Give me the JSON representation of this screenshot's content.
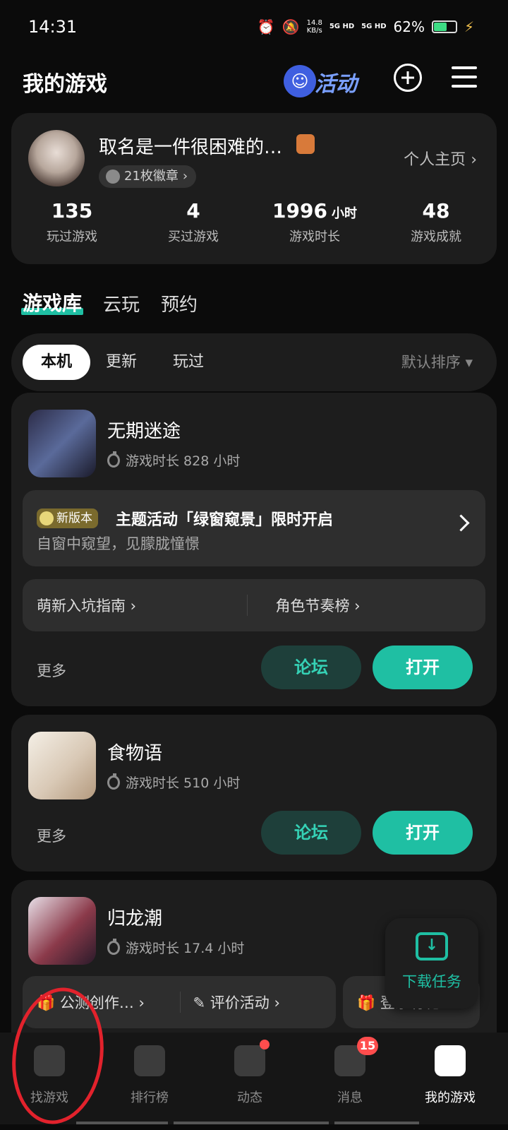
{
  "status_bar": {
    "time": "14:31",
    "speed_value": "14.8",
    "speed_unit": "KB/s",
    "net1": "5G HD",
    "net2": "5G HD",
    "battery": "62%",
    "battery_level": 0.62
  },
  "header": {
    "title": "我的游戏",
    "activity_label": "活动"
  },
  "profile": {
    "name": "取名是一件很困难的…",
    "medals": "21枚徽章",
    "homepage": "个人主页",
    "stats": [
      {
        "value": "135",
        "unit": "",
        "label": "玩过游戏"
      },
      {
        "value": "4",
        "unit": "",
        "label": "买过游戏"
      },
      {
        "value": "1996",
        "unit": "小时",
        "label": "游戏时长"
      },
      {
        "value": "48",
        "unit": "",
        "label": "游戏成就"
      }
    ]
  },
  "tabs": [
    "游戏库",
    "云玩",
    "预约"
  ],
  "filters": {
    "chips": [
      "本机",
      "更新",
      "玩过"
    ],
    "sort": "默认排序"
  },
  "games": [
    {
      "name": "无期迷途",
      "time": "游戏时长 828 小时",
      "notice": {
        "badge": "新版本",
        "title": "主题活动「绿窗窥景」限时开启",
        "sub": "自窗中窥望，见朦胧憧憬"
      },
      "links": [
        "萌新入坑指南 ›",
        "角色节奏榜 ›"
      ],
      "more": "更多",
      "forum": "论坛",
      "open": "打开"
    },
    {
      "name": "食物语",
      "time": "游戏时长 510 小时",
      "more": "更多",
      "forum": "论坛",
      "open": "打开"
    },
    {
      "name": "归龙潮",
      "time": "游戏时长 17.4 小时",
      "pills": [
        "公测创作… ›",
        "评价活动 ›",
        "登录有礼"
      ]
    }
  ],
  "download": {
    "label": "下载任务"
  },
  "bottom_nav": [
    {
      "label": "找游戏",
      "active": false
    },
    {
      "label": "排行榜",
      "active": false
    },
    {
      "label": "动态",
      "active": false
    },
    {
      "label": "消息",
      "badge": "15",
      "active": false
    },
    {
      "label": "我的游戏",
      "active": true
    }
  ],
  "colors": {
    "accent": "#1fbfa3",
    "background": "#0b0b0b",
    "card": "#1d1d1d",
    "badge_red": "#ff4d4d"
  }
}
